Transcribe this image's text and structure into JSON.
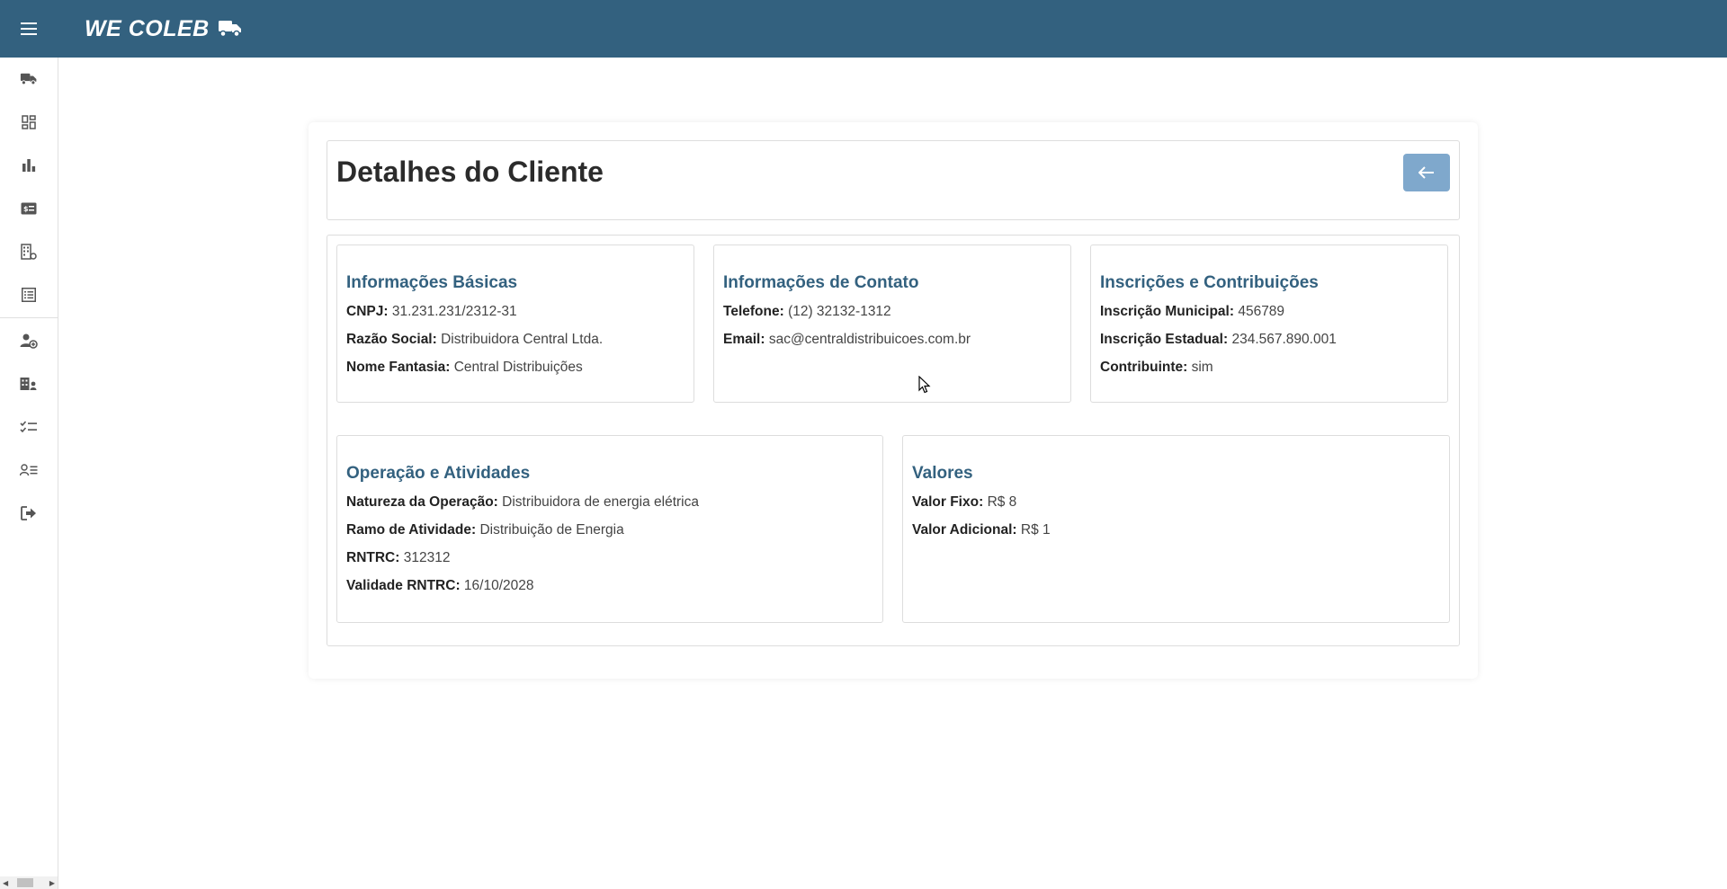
{
  "app": {
    "brand": "WE COLEB",
    "brand_icon": "truck-icon",
    "accent_color": "#33617f"
  },
  "sidebar": {
    "items": [
      {
        "icon": "truck-icon"
      },
      {
        "icon": "dashboard-icon"
      },
      {
        "icon": "bar-chart-icon"
      },
      {
        "icon": "money-card-icon"
      },
      {
        "icon": "building-settings-icon"
      },
      {
        "icon": "list-icon"
      },
      {
        "icon": "user-add-icon"
      },
      {
        "icon": "building-user-icon"
      },
      {
        "icon": "checklist-icon"
      },
      {
        "icon": "user-list-icon"
      },
      {
        "icon": "logout-icon"
      }
    ]
  },
  "page": {
    "title": "Detalhes do Cliente",
    "back_icon": "arrow-left-icon"
  },
  "cards": {
    "basic": {
      "title": "Informações Básicas",
      "rows": [
        {
          "label": "CNPJ:",
          "value": "31.231.231/2312-31"
        },
        {
          "label": "Razão Social:",
          "value": "Distribuidora Central Ltda."
        },
        {
          "label": "Nome Fantasia:",
          "value": "Central Distribuições"
        }
      ]
    },
    "contact": {
      "title": "Informações de Contato",
      "rows": [
        {
          "label": "Telefone:",
          "value": "(12) 32132-1312"
        },
        {
          "label": "Email:",
          "value": "sac@centraldistribuicoes.com.br"
        }
      ]
    },
    "registrations": {
      "title": "Inscrições e Contribuições",
      "rows": [
        {
          "label": "Inscrição Municipal:",
          "value": "456789"
        },
        {
          "label": "Inscrição Estadual:",
          "value": "234.567.890.001"
        },
        {
          "label": "Contribuinte:",
          "value": "sim"
        }
      ]
    },
    "operation": {
      "title": "Operação e Atividades",
      "rows": [
        {
          "label": "Natureza da Operação:",
          "value": "Distribuidora de energia elétrica"
        },
        {
          "label": "Ramo de Atividade:",
          "value": "Distribuição de Energia"
        },
        {
          "label": "RNTRC:",
          "value": "312312"
        },
        {
          "label": "Validade RNTRC:",
          "value": "16/10/2028"
        }
      ]
    },
    "values": {
      "title": "Valores",
      "rows": [
        {
          "label": "Valor Fixo:",
          "value": "R$ 8"
        },
        {
          "label": "Valor Adicional:",
          "value": "R$ 1"
        }
      ]
    }
  }
}
